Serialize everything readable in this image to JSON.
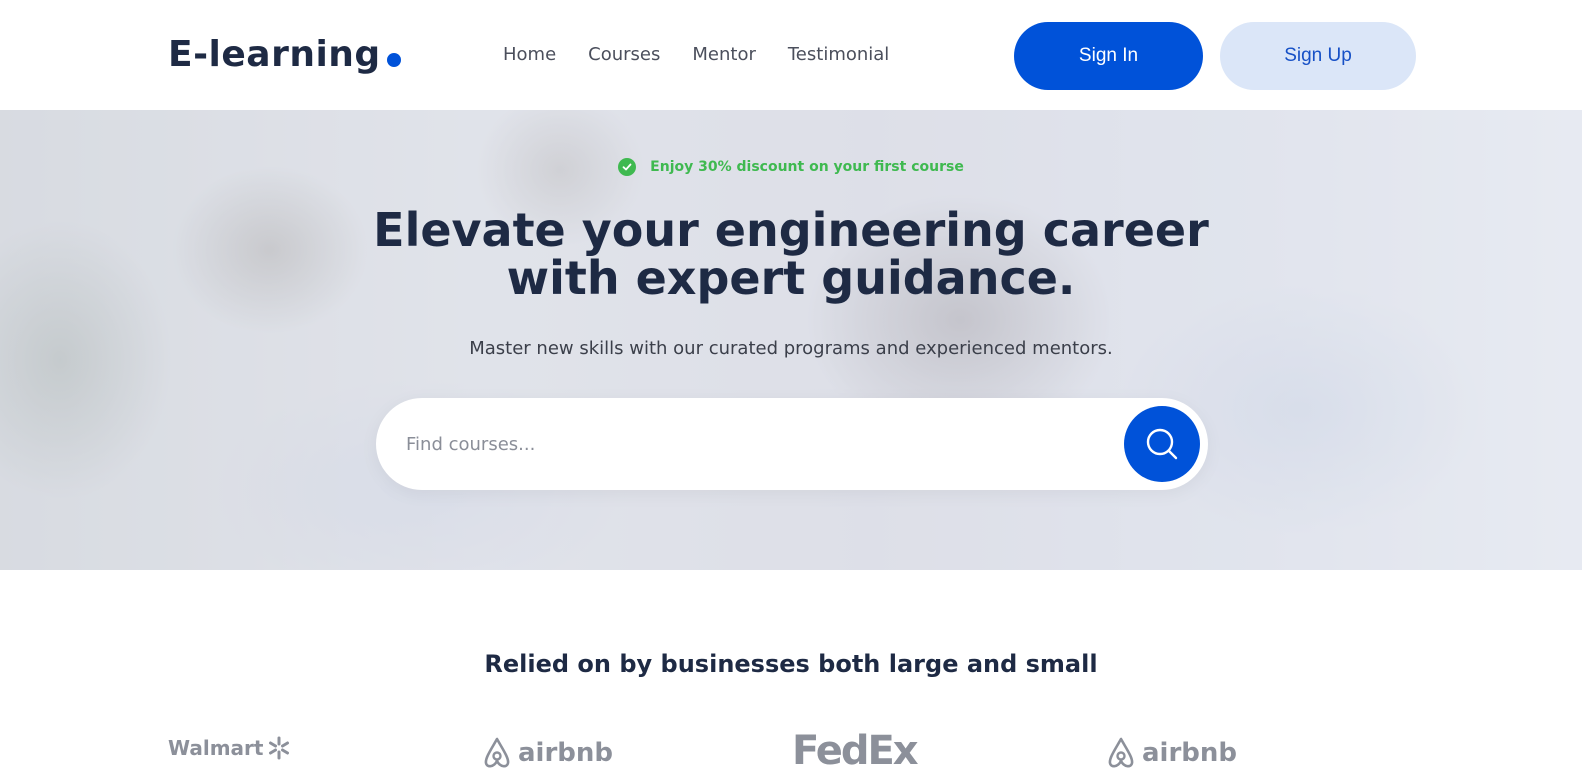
{
  "header": {
    "logo": "E-learning",
    "nav": [
      "Home",
      "Courses",
      "Mentor",
      "Testimonial"
    ],
    "sign_in": "Sign In",
    "sign_up": "Sign Up"
  },
  "hero": {
    "discount": "Enjoy 30% discount on your first course",
    "title_line1": "Elevate your engineering career",
    "title_line2": "with expert guidance.",
    "subtitle": "Master new skills with our curated programs and experienced mentors.",
    "search_placeholder": "Find courses..."
  },
  "trusted": {
    "title": "Relied on by businesses both large and small",
    "brands": [
      "Walmart",
      "airbnb",
      "FedEx",
      "airbnb"
    ]
  },
  "colors": {
    "primary": "#0052d9",
    "secondary_bg": "#dbe6f8",
    "accent_green": "#3fb950",
    "text_dark": "#1e2a44"
  }
}
